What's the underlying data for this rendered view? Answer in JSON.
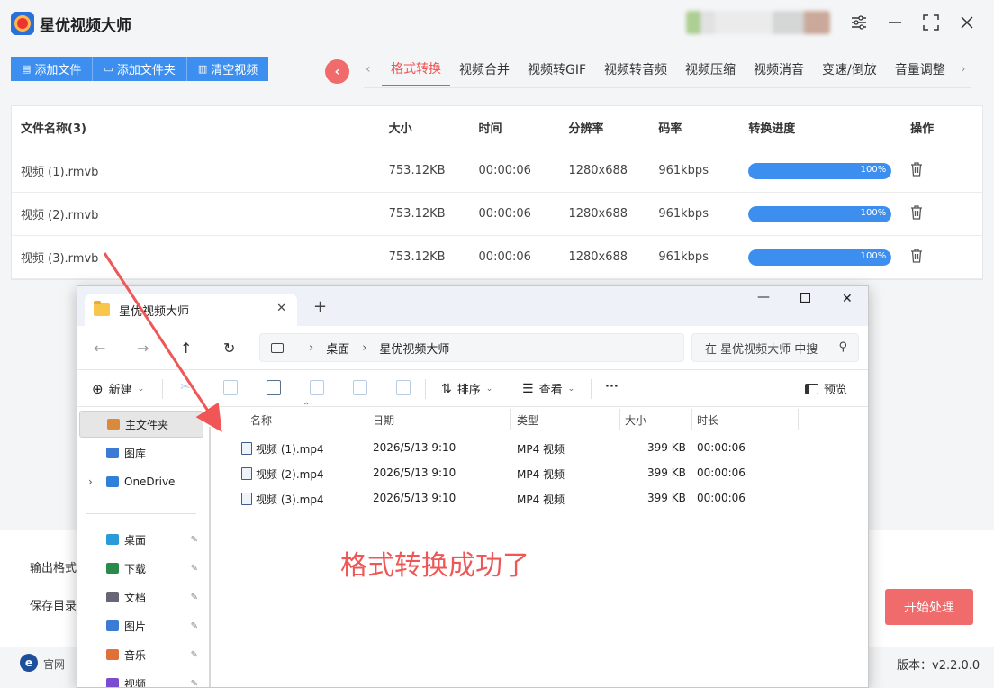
{
  "app": {
    "title": "星优视频大师",
    "toolbar": {
      "add_file": "添加文件",
      "add_folder": "添加文件夹",
      "clear": "清空视频"
    },
    "tabs": [
      "格式转换",
      "视频合并",
      "视频转GIF",
      "视频转音频",
      "视频压缩",
      "视频消音",
      "变速/倒放",
      "音量调整"
    ],
    "active_tab": "格式转换",
    "table": {
      "headers": {
        "name": "文件名称(3)",
        "size": "大小",
        "time": "时间",
        "resolution": "分辨率",
        "bitrate": "码率",
        "progress": "转换进度",
        "action": "操作"
      },
      "rows": [
        {
          "name": "视频 (1).rmvb",
          "size": "753.12KB",
          "time": "00:00:06",
          "resolution": "1280x688",
          "bitrate": "961kbps",
          "progress": "100%"
        },
        {
          "name": "视频 (2).rmvb",
          "size": "753.12KB",
          "time": "00:00:06",
          "resolution": "1280x688",
          "bitrate": "961kbps",
          "progress": "100%"
        },
        {
          "name": "视频 (3).rmvb",
          "size": "753.12KB",
          "time": "00:00:06",
          "resolution": "1280x688",
          "bitrate": "961kbps",
          "progress": "100%"
        }
      ]
    },
    "output_format_label": "输出格式",
    "save_dir_label": "保存目录",
    "start_button": "开始处理",
    "official_site": "官网",
    "version": "版本：v2.2.0.0",
    "accent_color": "#3d8fef",
    "highlight_color": "#f05050"
  },
  "explorer": {
    "tab_title": "星优视频大师",
    "breadcrumb": [
      "桌面",
      "星优视频大师"
    ],
    "search_placeholder": "在 星优视频大师 中搜",
    "toolbar": {
      "new": "新建",
      "sort": "排序",
      "view": "查看",
      "more": "···",
      "preview": "预览"
    },
    "nav": [
      {
        "label": "主文件夹",
        "icon": "home-icon"
      },
      {
        "label": "图库",
        "icon": "gallery-icon"
      },
      {
        "label": "OneDrive",
        "icon": "cloud-icon"
      },
      {
        "label": "桌面",
        "icon": "desktop-icon"
      },
      {
        "label": "下载",
        "icon": "download-icon"
      },
      {
        "label": "文档",
        "icon": "document-icon"
      },
      {
        "label": "图片",
        "icon": "pictures-icon"
      },
      {
        "label": "音乐",
        "icon": "music-icon"
      },
      {
        "label": "视频",
        "icon": "video-icon"
      }
    ],
    "columns": {
      "name": "名称",
      "date": "日期",
      "type": "类型",
      "size": "大小",
      "duration": "时长"
    },
    "files": [
      {
        "name": "视频 (1).mp4",
        "date": "2026/5/13 9:10",
        "type": "MP4 视频",
        "size": "399 KB",
        "duration": "00:00:06"
      },
      {
        "name": "视频 (2).mp4",
        "date": "2026/5/13 9:10",
        "type": "MP4 视频",
        "size": "399 KB",
        "duration": "00:00:06"
      },
      {
        "name": "视频 (3).mp4",
        "date": "2026/5/13 9:10",
        "type": "MP4 视频",
        "size": "399 KB",
        "duration": "00:00:06"
      }
    ]
  },
  "annotation": "格式转换成功了"
}
